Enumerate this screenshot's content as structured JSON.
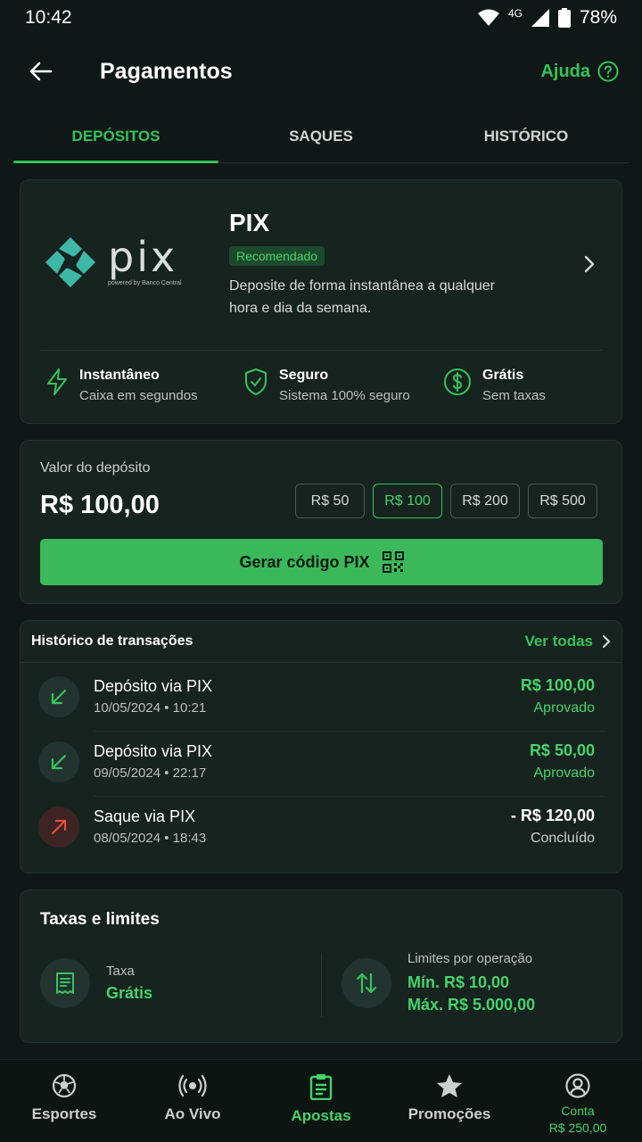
{
  "status": {
    "time": "10:42",
    "network": "4G",
    "battery": "78%"
  },
  "header": {
    "title": "Pagamentos",
    "help_label": "Ajuda"
  },
  "tabs": [
    {
      "label": "DEPÓSITOS",
      "active": true
    },
    {
      "label": "SAQUES",
      "active": false
    },
    {
      "label": "HISTÓRICO",
      "active": false
    }
  ],
  "pix": {
    "logo_text": "pix",
    "logo_subtext": "powered by Banco Central",
    "title": "PIX",
    "badge": "Recomendado",
    "description": "Deposite de forma instantânea a qualquer hora e dia da semana.",
    "features": [
      {
        "icon": "lightning-icon",
        "title": "Instantâneo",
        "subtitle": "Caixa em segundos"
      },
      {
        "icon": "shield-icon",
        "title": "Seguro",
        "subtitle": "Sistema 100% seguro"
      },
      {
        "icon": "dollar-circle-icon",
        "title": "Grátis",
        "subtitle": "Sem taxas"
      }
    ]
  },
  "deposit": {
    "label": "Valor do depósito",
    "value": "R$ 100,00",
    "chips": [
      "R$ 50",
      "R$ 100",
      "R$ 200",
      "R$ 500"
    ],
    "selected_chip": "R$ 100",
    "button_label": "Gerar código PIX"
  },
  "history": {
    "title": "Histórico de transações",
    "see_all": "Ver todas",
    "items": [
      {
        "name": "Depósito via PIX",
        "date": "10/05/2024 • 10:21",
        "amount": "R$ 100,00",
        "status": "Aprovado",
        "direction": "in"
      },
      {
        "name": "Depósito via PIX",
        "date": "09/05/2024 • 22:17",
        "amount": "R$ 50,00",
        "status": "Aprovado",
        "direction": "in"
      },
      {
        "name": "Saque via PIX",
        "date": "08/05/2024 • 18:43",
        "amount": "- R$ 120,00",
        "status": "Concluído",
        "direction": "out"
      }
    ]
  },
  "fees": {
    "title": "Taxas e limites",
    "fee_label": "Taxa",
    "fee_value": "Grátis",
    "limits_label": "Limites por operação",
    "min": "Mín. R$ 10,00",
    "max": "Máx. R$ 5.000,00"
  },
  "nav": [
    {
      "label": "Esportes",
      "icon": "soccer-ball-icon",
      "active": false
    },
    {
      "label": "Ao Vivo",
      "icon": "live-broadcast-icon",
      "active": false
    },
    {
      "label": "Apostas",
      "icon": "clipboard-icon",
      "active": true
    },
    {
      "label": "Promoções",
      "icon": "star-icon",
      "active": false
    },
    {
      "label": "Conta",
      "icon": "user-circle-icon",
      "active": false,
      "balance": "R$ 250,00"
    }
  ],
  "colors": {
    "accent": "#35c35a",
    "background": "#0f1816",
    "card": "#16231f",
    "withdraw": "#e8493a"
  }
}
